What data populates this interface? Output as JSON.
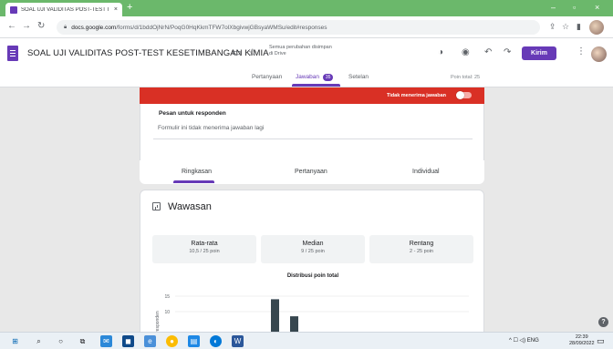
{
  "browser": {
    "tab_title": "SOAL UJI VALIDITAS POST-TEST I",
    "tab_close": "×",
    "new_tab": "+",
    "url_domain": "docs.google.com",
    "url_path": "/forms/d/1bddOjNrN/PoqG0HqKkmTFW7olXbgivwjGBsyaWMSu/edit#responses",
    "window_min": "–",
    "window_max": "▫",
    "window_close": "×"
  },
  "app": {
    "title": "SOAL UJI VALIDITAS POST-TEST KESETIMBANGAN KIMIA",
    "save_status_line1": "Semua perubahan disimpan",
    "save_status_line2": "di Drive",
    "send_label": "Kirim",
    "accent": "#673ab7"
  },
  "tabs": {
    "questions": "Pertanyaan",
    "responses": "Jawaban",
    "responses_count": "35",
    "settings": "Setelan",
    "points_total": "Poin total: 25"
  },
  "responses_panel": {
    "not_accepting": "Tidak menerima jawaban",
    "message_title": "Pesan untuk responden",
    "message_text": "Formulir ini tidak menerima jawaban lagi",
    "banner_color": "#d93025"
  },
  "summary_tabs": {
    "summary": "Ringkasan",
    "question": "Pertanyaan",
    "individual": "Individual"
  },
  "insights": {
    "title": "Wawasan",
    "mean_label": "Rata-rata",
    "mean_value": "10,5 / 25 poin",
    "median_label": "Median",
    "median_value": "9 / 25 poin",
    "range_label": "Rentang",
    "range_value": "2 - 25 poin",
    "distribution_title": "Distribusi poin total"
  },
  "chart_data": {
    "type": "bar",
    "title": "Distribusi poin total",
    "ylabel": "responden",
    "yticks": [
      "15",
      "10"
    ],
    "ylim": [
      0,
      15
    ],
    "values_visible": [
      {
        "category": "bar-a",
        "value": 14
      },
      {
        "category": "bar-b",
        "value": 8.5
      }
    ]
  },
  "taskbar": {
    "tray_text": "^ ☐ ◁) ENG",
    "time": "22:39",
    "date": "28/09/2022"
  },
  "help": "?"
}
